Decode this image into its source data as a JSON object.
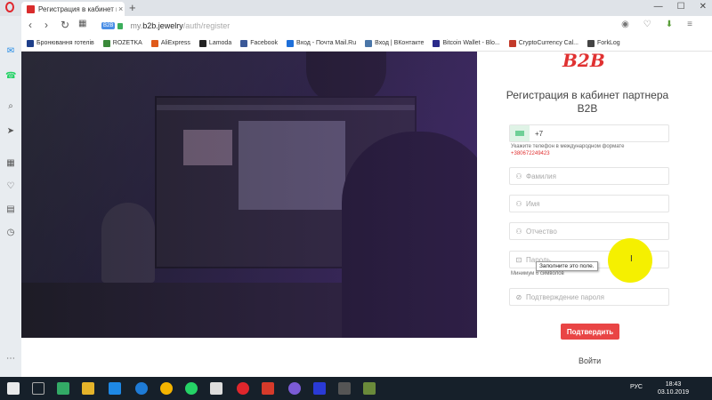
{
  "browser": {
    "tab_title": "Регистрация в кабинет па",
    "tab_close": "×",
    "new_tab": "+",
    "url": {
      "badge": "B2B",
      "host": "my.",
      "domain": "b2b.jewelry",
      "path": "/auth/register"
    }
  },
  "bookmarks": [
    {
      "label": "Бронювання готелів",
      "color": "#1e3f8a"
    },
    {
      "label": "ROZETKA",
      "color": "#3a8a3a"
    },
    {
      "label": "AliExpress",
      "color": "#e05a1a"
    },
    {
      "label": "Lamoda",
      "color": "#222222"
    },
    {
      "label": "Facebook",
      "color": "#3b5998"
    },
    {
      "label": "Вход - Почта Mail.Ru",
      "color": "#1e6fd9"
    },
    {
      "label": "Вход | ВКонтакте",
      "color": "#4a76a8"
    },
    {
      "label": "Bitcoin Wallet - Blo...",
      "color": "#2a2a8a"
    },
    {
      "label": "CryptoCurrency Cal...",
      "color": "#c33a2a"
    },
    {
      "label": "ForkLog",
      "color": "#444444"
    }
  ],
  "form": {
    "logo": "B2B",
    "title": "Регистрация в кабинет партнера B2B",
    "phone_code": "+7",
    "phone_hint": "Укажите телефон в международном формате",
    "phone_example": "+380672249423",
    "surname_placeholder": "Фамилия",
    "name_placeholder": "Имя",
    "patronymic_placeholder": "Отчество",
    "password_placeholder": "Пароль",
    "password_hint": "Минимум 6 символов",
    "tooltip": "Заполните это поле.",
    "confirm_placeholder": "Подтверждение пароля",
    "submit_label": "Подтвердить",
    "login_label": "Войти",
    "cursor": "I"
  },
  "taskbar": {
    "lang": "РУС",
    "time": "18:43",
    "date": "03.10.2019"
  },
  "colors": {
    "accent": "#e94545",
    "highlight": "#f5f000"
  }
}
